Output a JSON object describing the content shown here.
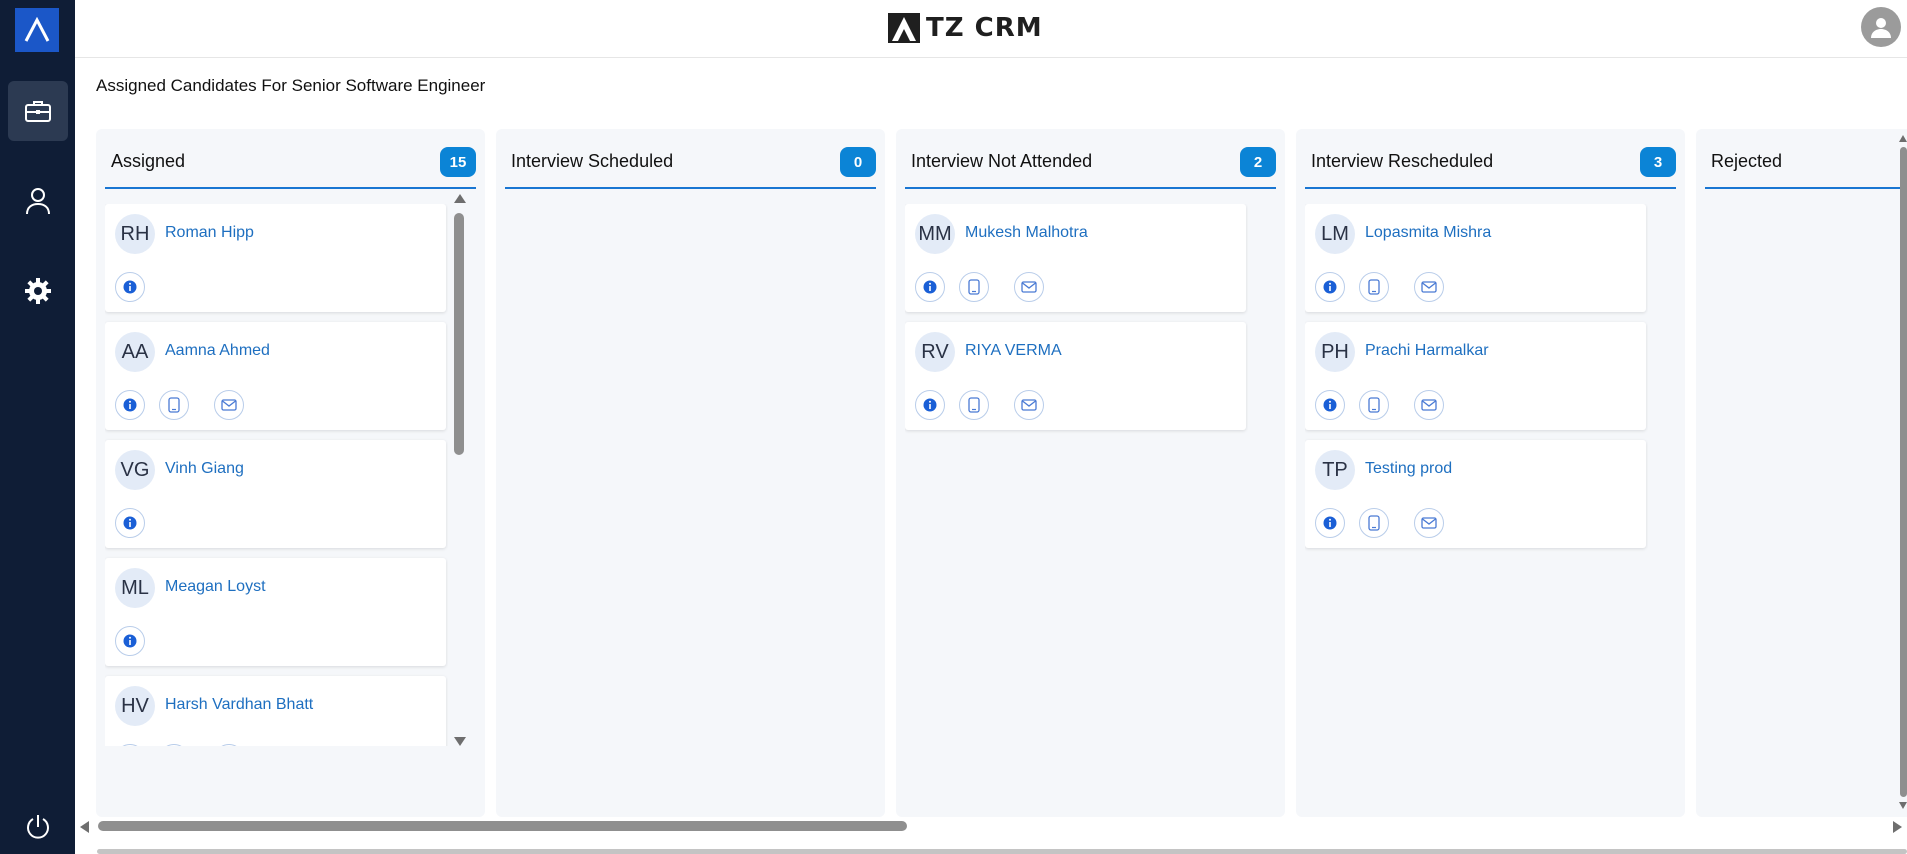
{
  "app": {
    "brand": "TZ CRM"
  },
  "page": {
    "title": "Assigned Candidates For Senior Software Engineer"
  },
  "colors": {
    "sidebar": "#0f1d36",
    "accent": "#1976d2",
    "badge": "#0b84d6",
    "link": "#1e6fc0"
  },
  "columns": [
    {
      "title": "Assigned",
      "count": "15",
      "cards": [
        {
          "initials": "RH",
          "name": "Roman Hipp",
          "actions": [
            "info"
          ]
        },
        {
          "initials": "AA",
          "name": "Aamna Ahmed",
          "actions": [
            "info",
            "phone",
            "mail"
          ]
        },
        {
          "initials": "VG",
          "name": "Vinh Giang",
          "actions": [
            "info"
          ]
        },
        {
          "initials": "ML",
          "name": "Meagan Loyst",
          "actions": [
            "info"
          ]
        },
        {
          "initials": "HV",
          "name": "Harsh Vardhan Bhatt",
          "actions": [
            "info",
            "phone",
            "mail"
          ]
        }
      ]
    },
    {
      "title": "Interview Scheduled",
      "count": "0",
      "cards": []
    },
    {
      "title": "Interview Not Attended",
      "count": "2",
      "cards": [
        {
          "initials": "MM",
          "name": "Mukesh Malhotra",
          "actions": [
            "info",
            "phone",
            "mail"
          ]
        },
        {
          "initials": "RV",
          "name": "RIYA VERMA",
          "actions": [
            "info",
            "phone",
            "mail"
          ]
        }
      ]
    },
    {
      "title": "Interview Rescheduled",
      "count": "3",
      "cards": [
        {
          "initials": "LM",
          "name": "Lopasmita Mishra",
          "actions": [
            "info",
            "phone",
            "mail"
          ]
        },
        {
          "initials": "PH",
          "name": "Prachi Harmalkar",
          "actions": [
            "info",
            "phone",
            "mail"
          ]
        },
        {
          "initials": "TP",
          "name": "Testing prod",
          "actions": [
            "info",
            "phone",
            "mail"
          ]
        }
      ]
    },
    {
      "title": "Rejected",
      "count": "",
      "cards": []
    }
  ]
}
